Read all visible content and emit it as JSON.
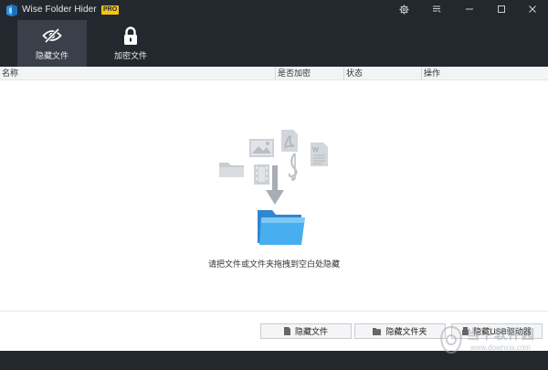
{
  "app": {
    "name": "Wise Folder Hider",
    "badge": "PRO"
  },
  "nav": {
    "tabs": [
      {
        "label": "隐藏文件",
        "active": true
      },
      {
        "label": "加密文件",
        "active": false
      }
    ]
  },
  "table": {
    "columns": [
      "名称",
      "是否加密",
      "状态",
      "操作"
    ]
  },
  "empty_state": {
    "hint": "请把文件或文件夹拖拽到空白处隐藏"
  },
  "actions": {
    "hide_file": "隐藏文件",
    "hide_folder": "隐藏文件夹",
    "hide_usb": "隐藏USB驱动器"
  },
  "watermark": {
    "text": "当下软件园",
    "url": "www.downxia.com"
  },
  "colors": {
    "chrome_bg": "#23282f",
    "active_tab": "#3a4049",
    "badge": "#f5c518",
    "folder_blue": "#3aa0e8"
  }
}
